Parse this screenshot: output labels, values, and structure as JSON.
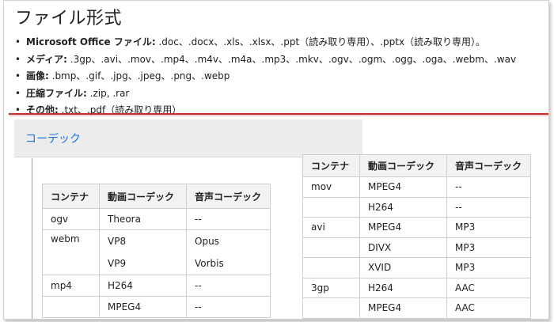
{
  "heading": "ファイル形式",
  "formats": [
    {
      "label": "Microsoft Office ファイル:",
      "text": " .doc、.docx、.xls、.xlsx、.ppt（読み取り専用）、.pptx（読み取り専用）。"
    },
    {
      "label": "メディア:",
      "text": " .3gp、.avi、.mov、.mp4、.m4v、.m4a、.mp3、.mkv、.ogv、.ogm、.ogg、.oga、.webm、.wav"
    },
    {
      "label": "画像:",
      "text": " .bmp、.gif、.jpg、.jpeg、.png、.webp"
    },
    {
      "label": "圧縮ファイル:",
      "text": " .zip, .rar"
    },
    {
      "label": "その他:",
      "text": " .txt、.pdf（読み取り専用）"
    }
  ],
  "codec_section": {
    "title": "コーデック"
  },
  "table_left": {
    "headers": [
      "コンテナ",
      "動画コーデック",
      "音声コーデック"
    ],
    "rows": [
      {
        "container": "ogv",
        "video": "Theora",
        "audio": "--"
      },
      {
        "container": "webm",
        "video": "VP8",
        "audio": "Opus",
        "video2": "VP9",
        "audio2": "Vorbis"
      },
      {
        "container": "mp4",
        "video": "H264",
        "audio": "--"
      },
      {
        "container": "",
        "video": "MPEG4",
        "audio": "--"
      }
    ]
  },
  "table_right": {
    "headers": [
      "コンテナ",
      "動画コーデック",
      "音声コーデック"
    ],
    "rows": [
      {
        "container": "mov",
        "video": "MPEG4",
        "audio": "--"
      },
      {
        "container": "",
        "video": "H264",
        "audio": "--"
      },
      {
        "container": "avi",
        "video": "MPEG4",
        "audio": "MP3"
      },
      {
        "container": "",
        "video": "DIVX",
        "audio": "MP3"
      },
      {
        "container": "",
        "video": "XVID",
        "audio": "MP3"
      },
      {
        "container": "3gp",
        "video": "H264",
        "audio": "AAC"
      },
      {
        "container": "",
        "video": "MPEG4",
        "audio": "AAC"
      }
    ]
  },
  "colors": {
    "accent_link": "#1a73e8",
    "divider_red": "#c4302b"
  }
}
